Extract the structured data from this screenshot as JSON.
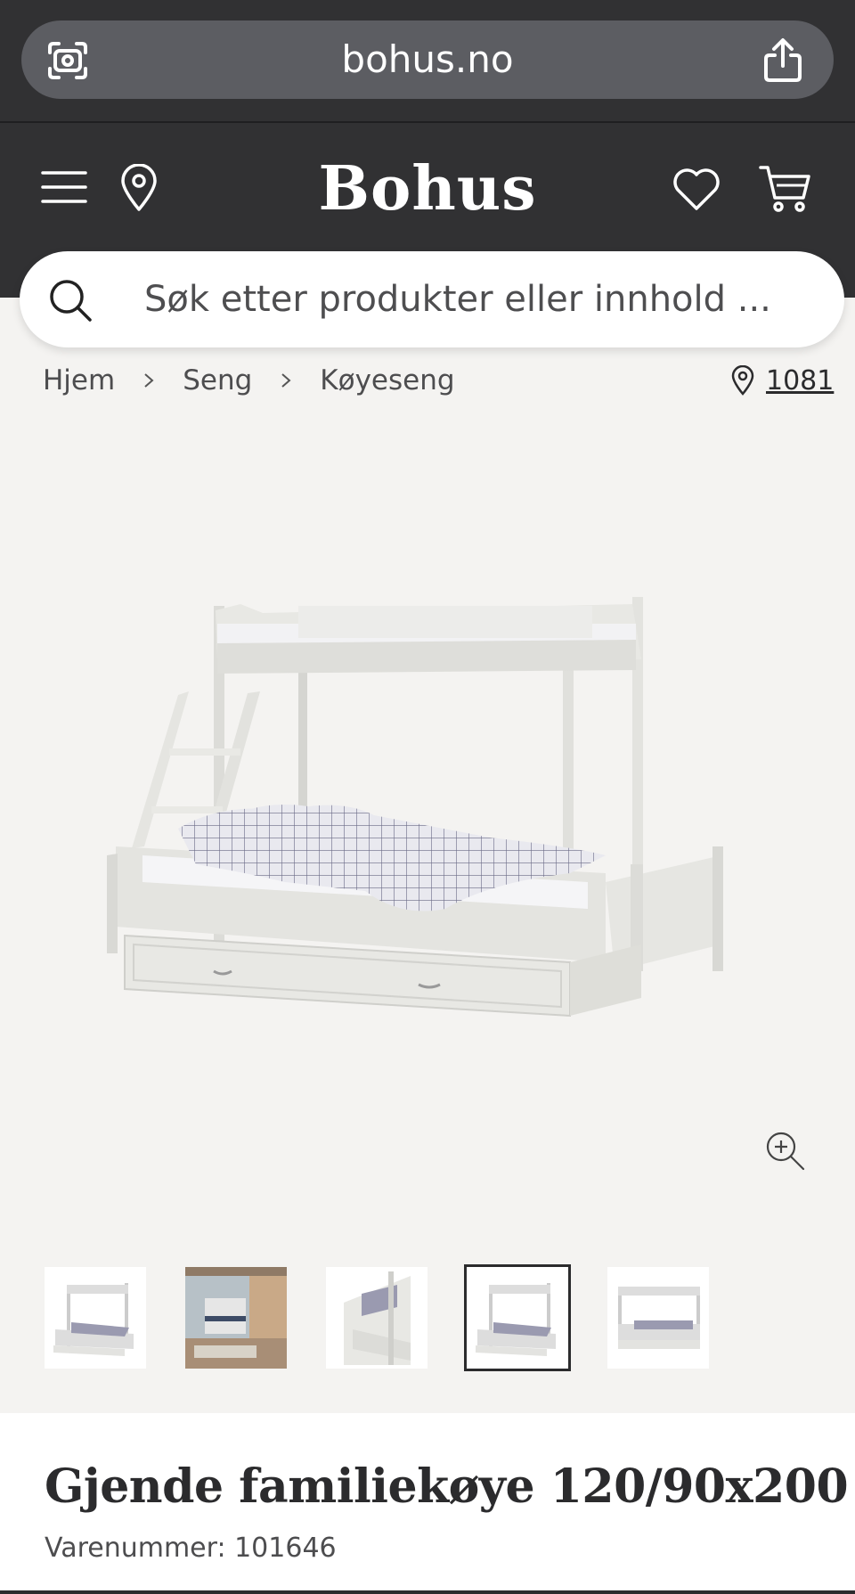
{
  "browser": {
    "url": "bohus.no",
    "camera_icon": "camera-scan-icon",
    "share_icon": "share-icon"
  },
  "header": {
    "logo": "Bohus",
    "menu_icon": "hamburger-menu-icon",
    "location_icon": "map-pin-icon",
    "wishlist_icon": "heart-icon",
    "cart_icon": "shopping-cart-icon"
  },
  "search": {
    "placeholder": "Søk etter produkter eller innhold ..."
  },
  "breadcrumb": {
    "items": [
      "Hjem",
      "Seng",
      "Køyeseng"
    ],
    "store_code": "1081"
  },
  "gallery": {
    "thumbnails": [
      "thumb-1",
      "thumb-2",
      "thumb-3",
      "thumb-4",
      "thumb-5"
    ],
    "selected_index": 3
  },
  "product": {
    "title": "Gjende familiekøye 120/90x200",
    "sku": "Varenummer: 101646"
  },
  "colors": {
    "header_bg": "#313133",
    "page_bg": "#f4f3f1",
    "text": "#2b2b2d"
  }
}
